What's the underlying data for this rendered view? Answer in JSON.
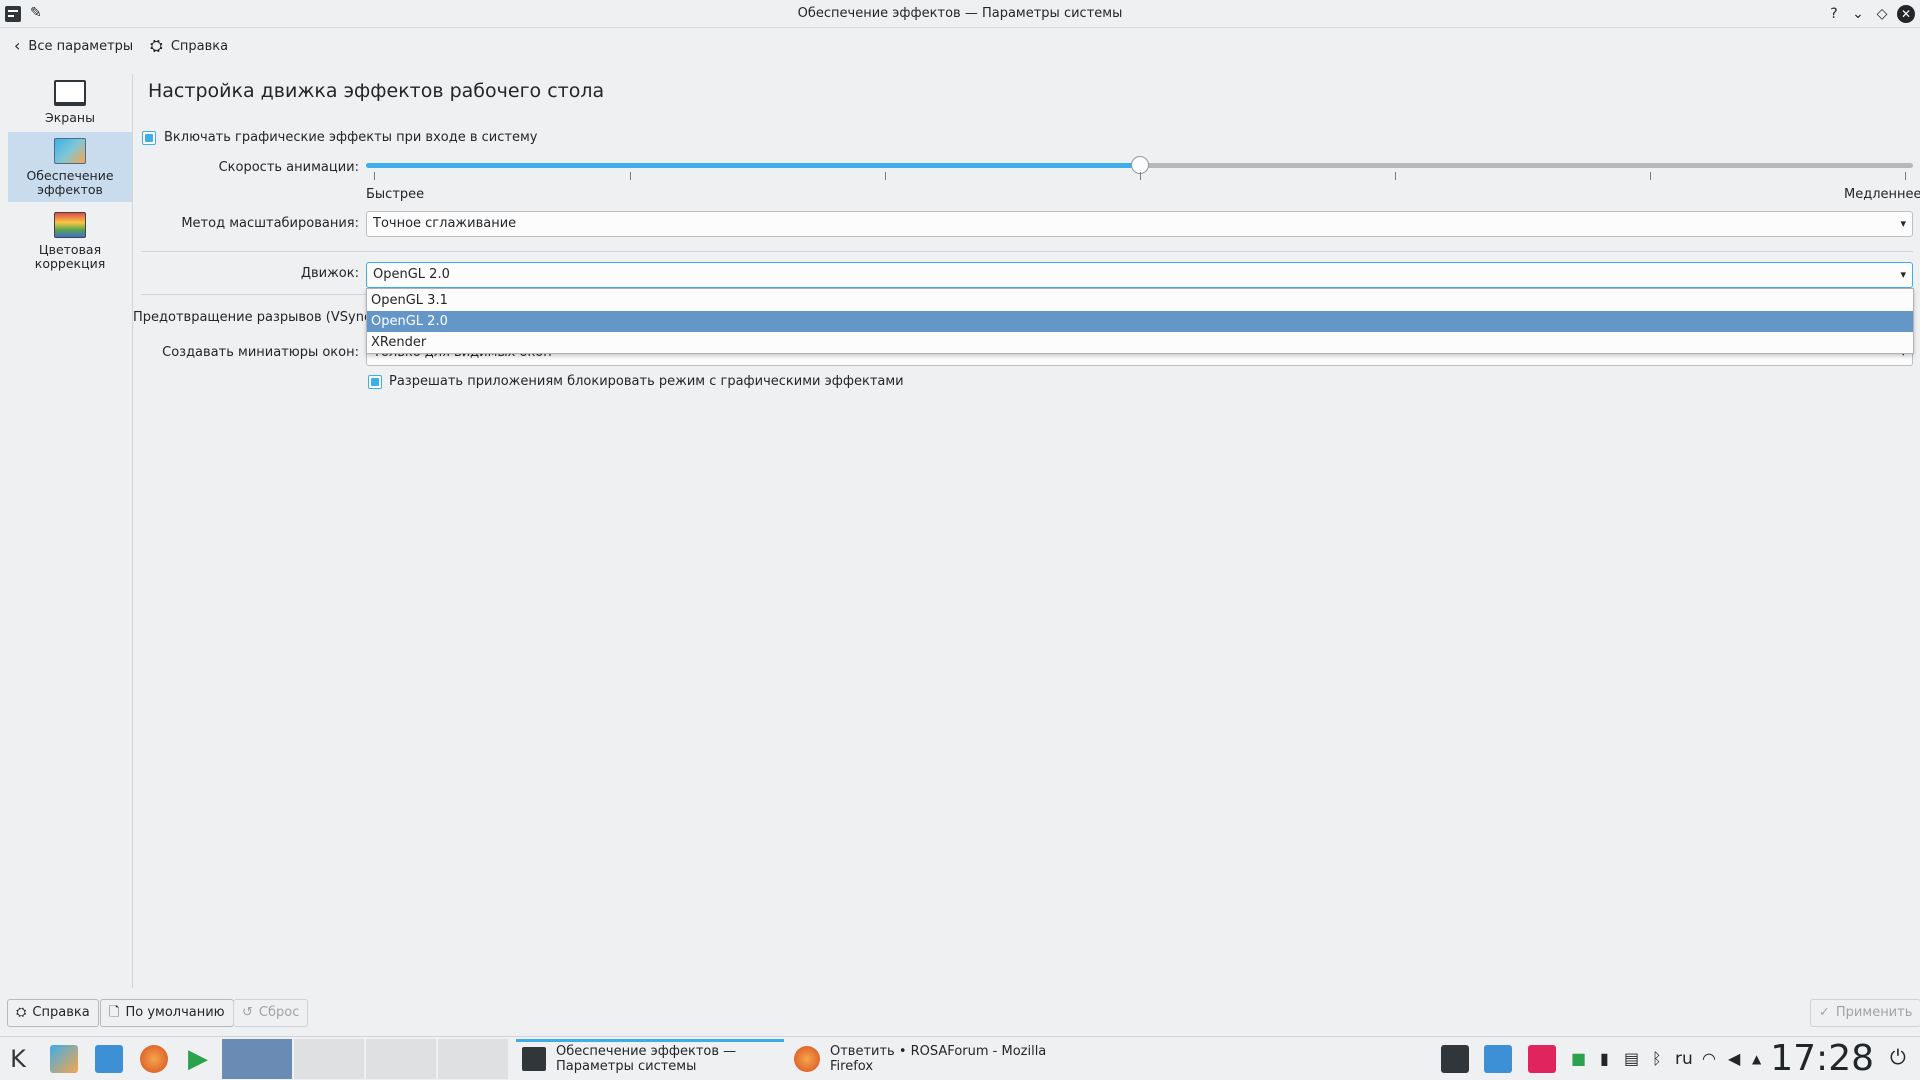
{
  "window": {
    "title": "Обеспечение эффектов — Параметры системы",
    "buttons": [
      "?",
      "⌄",
      "◇",
      "✕"
    ]
  },
  "toolbar": {
    "back_label": "Все параметры",
    "help_label": "Справка"
  },
  "sidebar": {
    "items": [
      {
        "label": "Экраны",
        "icon": "monitor-icon"
      },
      {
        "label": "Обеспечение эффектов",
        "icon": "effects-icon",
        "active": true
      },
      {
        "label": "Цветовая коррекция",
        "icon": "color-correction-icon"
      }
    ]
  },
  "main": {
    "title": "Настройка движка эффектов рабочего стола",
    "enable_effects_label": "Включать графические эффекты при входе в систему",
    "animation_speed_label": "Скорость анимации:",
    "animation_speed_value": 0.5,
    "faster_label": "Быстрее",
    "slower_label": "Медленнее",
    "scale_method_label": "Метод масштабирования:",
    "scale_method_value": "Точное сглаживание",
    "engine_label": "Движок:",
    "engine_value": "OpenGL 2.0",
    "engine_options": [
      "OpenGL 3.1",
      "OpenGL 2.0",
      "XRender"
    ],
    "vsync_label": "Предотвращение разрывов (VSync):",
    "thumbnails_label": "Создавать миниатюры окон:",
    "thumbnails_value": "Только для видимых окон",
    "allow_block_label": "Разрешать приложениям блокировать режим с графическими эффектами"
  },
  "bottom": {
    "help": "Справка",
    "defaults": "По умолчанию",
    "reset": "Сброс",
    "apply": "Применить"
  },
  "taskbar": {
    "tasks": [
      {
        "title": "Обеспечение эффектов —\nПараметры системы",
        "active": true
      },
      {
        "title": "Ответить • ROSAForum - Mozilla\nFirefox",
        "active": false
      }
    ],
    "language": "ru",
    "clock": "17:28"
  },
  "colors": {
    "accent": "#3daee9",
    "selection": "#6596c8",
    "background": "#eff0f1"
  }
}
